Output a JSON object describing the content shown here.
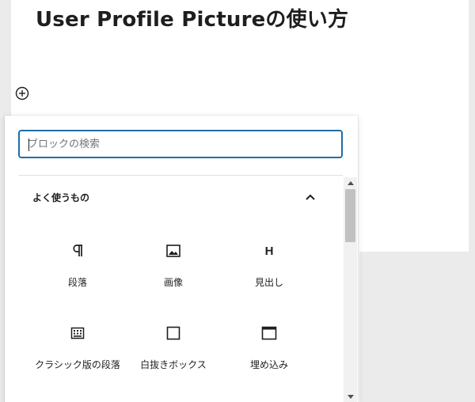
{
  "post": {
    "title": "User Profile Pictureの使い方"
  },
  "inserter": {
    "toggle_icon": "plus-circle-icon",
    "search": {
      "placeholder": "ブロックの検索",
      "value": ""
    },
    "panel": {
      "title": "よく使うもの",
      "expanded": true,
      "toggle_icon": "chevron-up-icon"
    },
    "blocks": [
      {
        "label": "段落",
        "icon": "pilcrow-icon"
      },
      {
        "label": "画像",
        "icon": "image-icon"
      },
      {
        "label": "見出し",
        "icon": "heading-icon",
        "glyph": "H"
      },
      {
        "label": "クラシック版の段落",
        "icon": "classic-editor-icon"
      },
      {
        "label": "白抜きボックス",
        "icon": "square-outline-icon"
      },
      {
        "label": "埋め込み",
        "icon": "embed-icon"
      }
    ],
    "scrollbar": {
      "up_icon": "scroll-up-arrow-icon",
      "down_icon": "scroll-down-arrow-icon"
    }
  },
  "colors": {
    "accent": "#1e6ea7",
    "text": "#1e1e1e",
    "background_gray": "#ebebeb"
  }
}
